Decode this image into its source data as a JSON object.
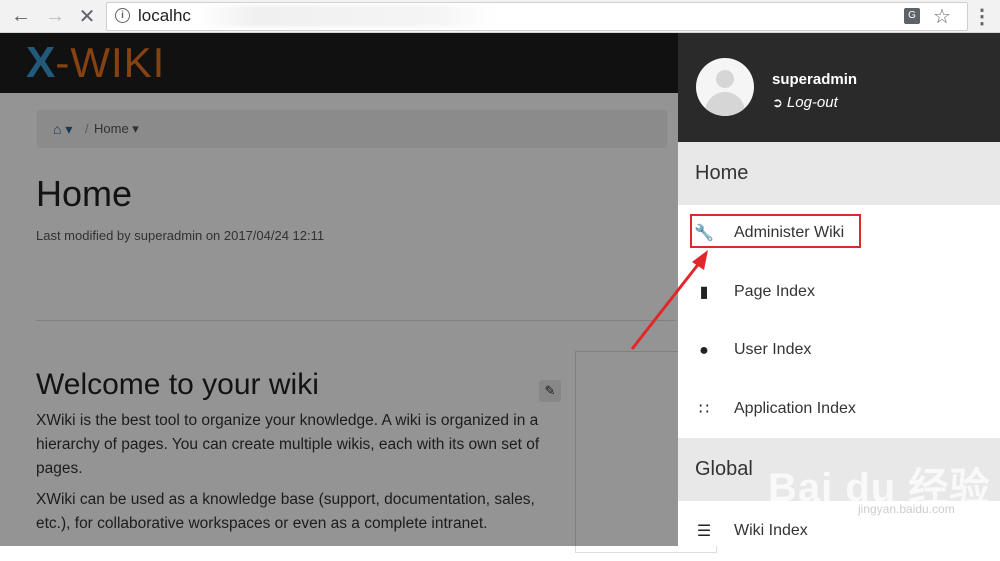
{
  "browser": {
    "url_visible": "localhc",
    "translate_icon": "translate-icon",
    "star_icon": "star-icon"
  },
  "header": {
    "logo_text": "WIKI",
    "logo_mark": "X"
  },
  "breadcrumb": {
    "current": "Home"
  },
  "page": {
    "title": "Home",
    "modified": "Last modified by superadmin on 2017/04/24 12:11",
    "welcome_heading": "Welcome to your wiki",
    "para1": "XWiki is the best tool to organize your knowledge. A wiki is organized in a hierarchy of pages. You can create multiple wikis, each with its own set of pages.",
    "para2": "XWiki can be used as a knowledge base (support, documentation, sales, etc.), for collaborative workspaces or even as a complete intranet."
  },
  "drawer": {
    "username": "superadmin",
    "logout": "Log-out",
    "section_home": "Home",
    "section_global": "Global",
    "items": [
      {
        "label": "Administer Wiki",
        "icon": "wrench-icon"
      },
      {
        "label": "Page Index",
        "icon": "book-icon"
      },
      {
        "label": "User Index",
        "icon": "user-icon"
      },
      {
        "label": "Application Index",
        "icon": "grid-icon"
      },
      {
        "label": "Wiki Index",
        "icon": "list-icon"
      }
    ]
  },
  "watermark": {
    "brand": "Bai du 经验",
    "site": "jingyan.baidu.com"
  },
  "colors": {
    "highlight": "#e0282b",
    "drawer_header": "#2a2a2a",
    "logo_orange": "#e8731f"
  }
}
